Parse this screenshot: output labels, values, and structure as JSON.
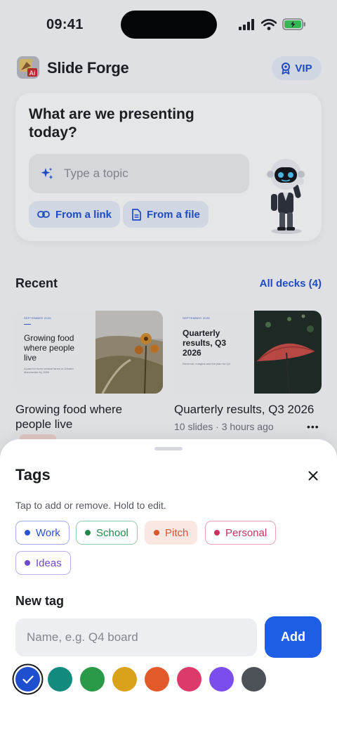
{
  "status_bar": {
    "time": "09:41"
  },
  "header": {
    "app_title": "Slide Forge",
    "vip_label": "VIP"
  },
  "hero": {
    "question": "What are we presenting today?",
    "topic_placeholder": "Type a topic",
    "from_link_label": "From a link",
    "from_file_label": "From a file"
  },
  "recent": {
    "label": "Recent",
    "all_decks_label": "All decks (4)",
    "decks": [
      {
        "name": "Growing food where people live",
        "thumb_kicker": "SEPTEMBER 2026",
        "thumb_title": "Growing food where people live",
        "thumb_subtitle": "A plan for three vertical farms in Greater Manchester by 2026"
      },
      {
        "name": "Quarterly results, Q3 2026",
        "meta": "10 slides · 3 hours ago",
        "thumb_kicker": "SEPTEMBER 2026",
        "thumb_title": "Quarterly results, Q3 2026",
        "thumb_subtitle": "Revenue, margins and the plan for Q4"
      }
    ]
  },
  "sheet": {
    "title": "Tags",
    "hint": "Tap to add or remove. Hold to edit.",
    "tags": [
      {
        "label": "Work",
        "color": "#2b52d6",
        "selected": false
      },
      {
        "label": "School",
        "color": "#1f8a4c",
        "selected": false
      },
      {
        "label": "Pitch",
        "color": "#d9562f",
        "selected": true
      },
      {
        "label": "Personal",
        "color": "#c8335f",
        "selected": false
      },
      {
        "label": "Ideas",
        "color": "#6f49c9",
        "selected": false
      }
    ],
    "new_tag_label": "New tag",
    "name_placeholder": "Name, e.g. Q4 board",
    "add_label": "Add",
    "colors": [
      "#1d4fcf",
      "#138a7e",
      "#2b9a48",
      "#d9a21a",
      "#e35a2a",
      "#dd3a6c",
      "#7b4ded",
      "#4d5258"
    ],
    "selected_color": "#1d4fcf"
  }
}
